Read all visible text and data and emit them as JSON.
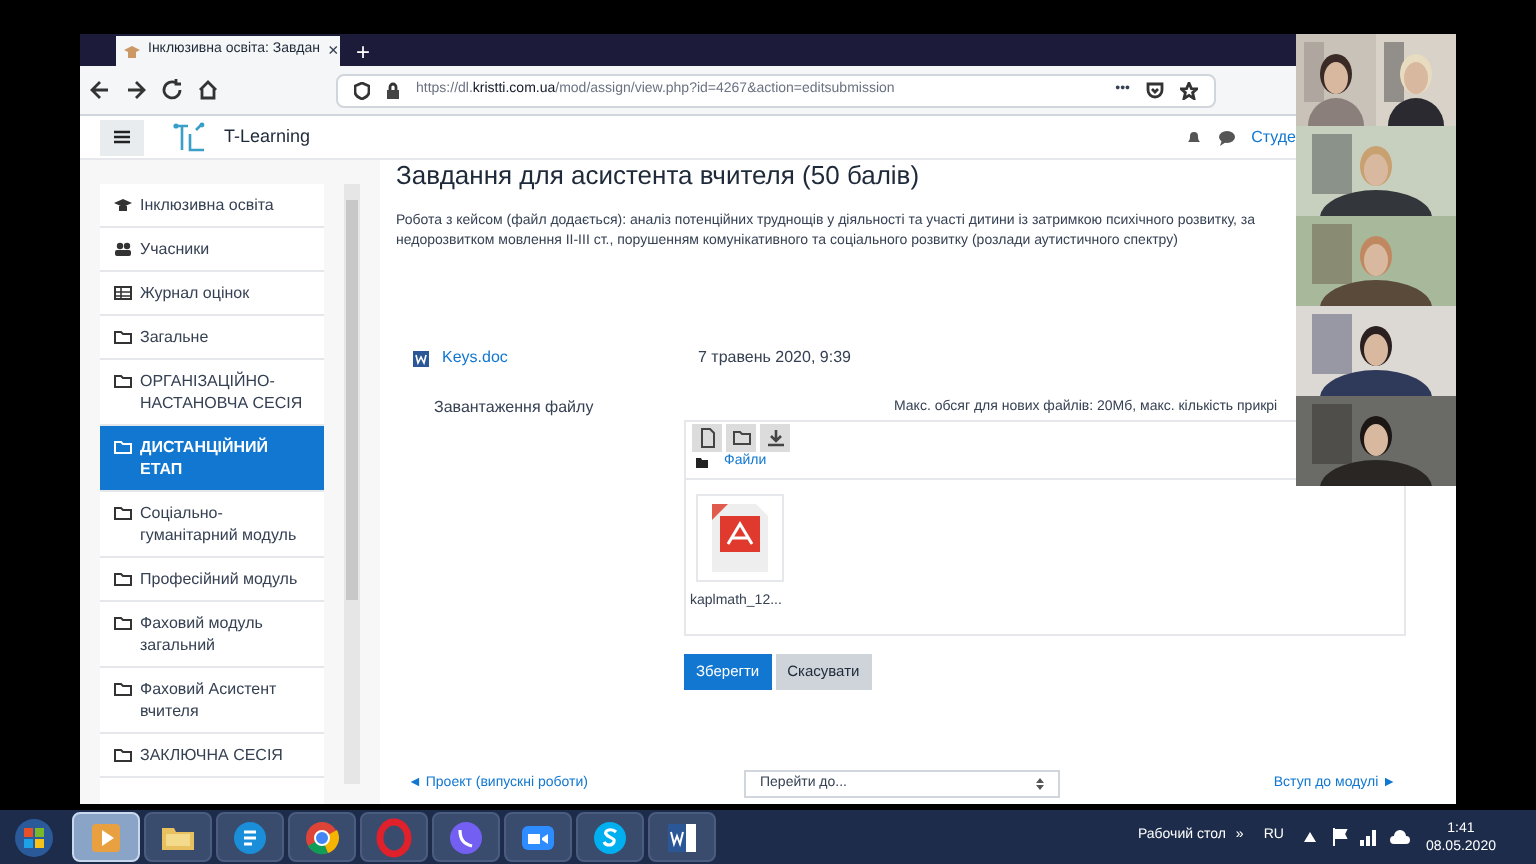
{
  "browser": {
    "tab_title": "Інклюзивна освіта: Завдан",
    "tab_close": "×",
    "new_tab": "+",
    "url_prefix": "https://dl.",
    "url_domain": "kristti.com.ua",
    "url_path": "/mod/assign/view.php?id=4267&action=editsubmission",
    "page_actions": "•••"
  },
  "site_header": {
    "brand": "T-Learning",
    "user": "Студе"
  },
  "sidebar": {
    "items": [
      {
        "label": "Інклюзивна освіта",
        "kind": "course",
        "selected": false
      },
      {
        "label": "Учасники",
        "kind": "participants",
        "selected": false
      },
      {
        "label": "Журнал оцінок",
        "kind": "grades",
        "selected": false
      },
      {
        "label": "Загальне",
        "kind": "section",
        "selected": false
      },
      {
        "label": "ОРГАНІЗАЦІЙНО-НАСТАНОВЧА СЕСІЯ",
        "kind": "section",
        "selected": false
      },
      {
        "label": "ДИСТАНЦІЙНИЙ ЕТАП",
        "kind": "section",
        "selected": true
      },
      {
        "label": "Соціально-гуманітарний модуль",
        "kind": "section",
        "selected": false
      },
      {
        "label": "Професійний модуль",
        "kind": "section",
        "selected": false
      },
      {
        "label": "Фаховий модуль загальний",
        "kind": "section",
        "selected": false
      },
      {
        "label": "Фаховий Асистент вчителя",
        "kind": "section",
        "selected": false
      },
      {
        "label": "ЗАКЛЮЧНА СЕСІЯ",
        "kind": "section",
        "selected": false
      }
    ]
  },
  "assignment": {
    "title": "Завдання для асистента вчителя (50 балів)",
    "description_lines": [
      "Робота з кейсом (файл додається): аналіз потенційних труднощів у діяльності та участі дитини із затримкою психічного розвитку, за",
      "недорозвитком мовлення ІІ-ІІІ ст., порушенням комунікативного та соціального розвитку (розлади аутистичного спектру)"
    ],
    "attachment": {
      "name": "Keys.doc",
      "date": "7 травень 2020, 9:39"
    }
  },
  "upload": {
    "label": "Завантаження файлу",
    "limits": "Макс. обсяг для нових файлів: 20Мб, макс. кількість прикрі",
    "path": "Файли",
    "files": [
      {
        "name": "kaplmath_12..."
      }
    ]
  },
  "buttons": [
    {
      "label": "Зберегти",
      "kind": "primary"
    },
    {
      "label": "Скасувати",
      "kind": "secondary"
    }
  ],
  "footer_nav": {
    "previous": "◄ Проект (випускні роботи)",
    "jump_placeholder": "Перейти до...",
    "next": "Вступ до модулі ►"
  },
  "taskbar": {
    "apps": [
      {
        "kind": "media",
        "selected": true
      },
      {
        "kind": "folder",
        "selected": false
      },
      {
        "kind": "skype-business",
        "selected": false
      },
      {
        "kind": "chrome",
        "selected": false
      },
      {
        "kind": "opera",
        "selected": false
      },
      {
        "kind": "viber",
        "selected": false
      },
      {
        "kind": "zoom",
        "selected": false
      },
      {
        "kind": "skype",
        "selected": false
      },
      {
        "kind": "word",
        "selected": false
      }
    ],
    "desktop_label": "Рабочий стол",
    "expand": "»",
    "language": "RU",
    "time": "1:41",
    "date": "08.05.2020"
  }
}
